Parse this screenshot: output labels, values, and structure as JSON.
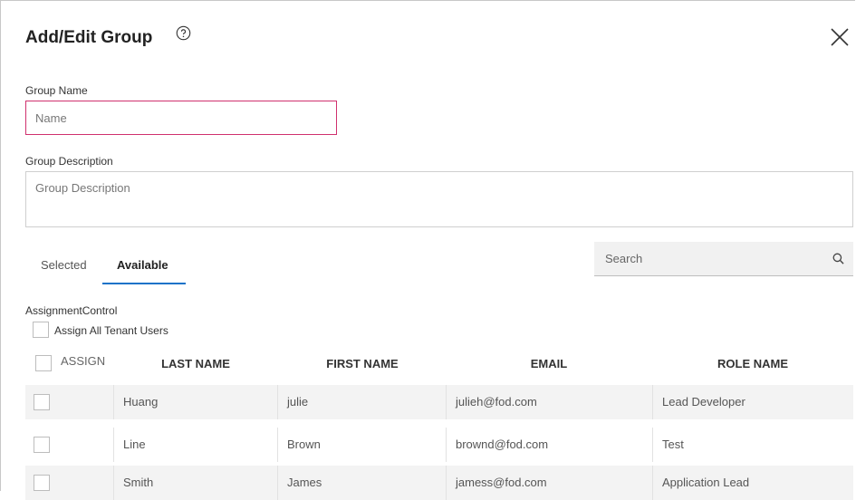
{
  "dialog": {
    "title": "Add/Edit Group",
    "help_icon": "help-circle-icon",
    "close_icon": "close-icon"
  },
  "form": {
    "group_name_label": "Group Name",
    "group_name_placeholder": "Name",
    "group_name_value": "",
    "group_description_label": "Group Description",
    "group_description_placeholder": "Group Description",
    "group_description_value": ""
  },
  "tabs": [
    {
      "label": "Selected",
      "active": false
    },
    {
      "label": "Available",
      "active": true
    }
  ],
  "search": {
    "placeholder": "Search",
    "value": "",
    "icon": "search-icon"
  },
  "assignment": {
    "control_label": "AssignmentControl",
    "assign_all_label": "Assign All Tenant Users",
    "assign_all_checked": false
  },
  "table": {
    "columns": [
      "ASSIGN",
      "LAST NAME",
      "FIRST NAME",
      "EMAIL",
      "ROLE NAME"
    ],
    "rows": [
      {
        "assigned": false,
        "last_name": "Huang",
        "first_name": "julie",
        "email": "julieh@fod.com",
        "role": "Lead Developer"
      },
      {
        "assigned": false,
        "last_name": "Line",
        "first_name": "Brown",
        "email": "brownd@fod.com",
        "role": "Test"
      },
      {
        "assigned": false,
        "last_name": "Smith",
        "first_name": "James",
        "email": "jamess@fod.com",
        "role": "Application Lead"
      }
    ]
  },
  "colors": {
    "active_tab_underline": "#1a73c8",
    "required_field_border": "#d0306e",
    "row_shade": "#f3f3f3"
  }
}
